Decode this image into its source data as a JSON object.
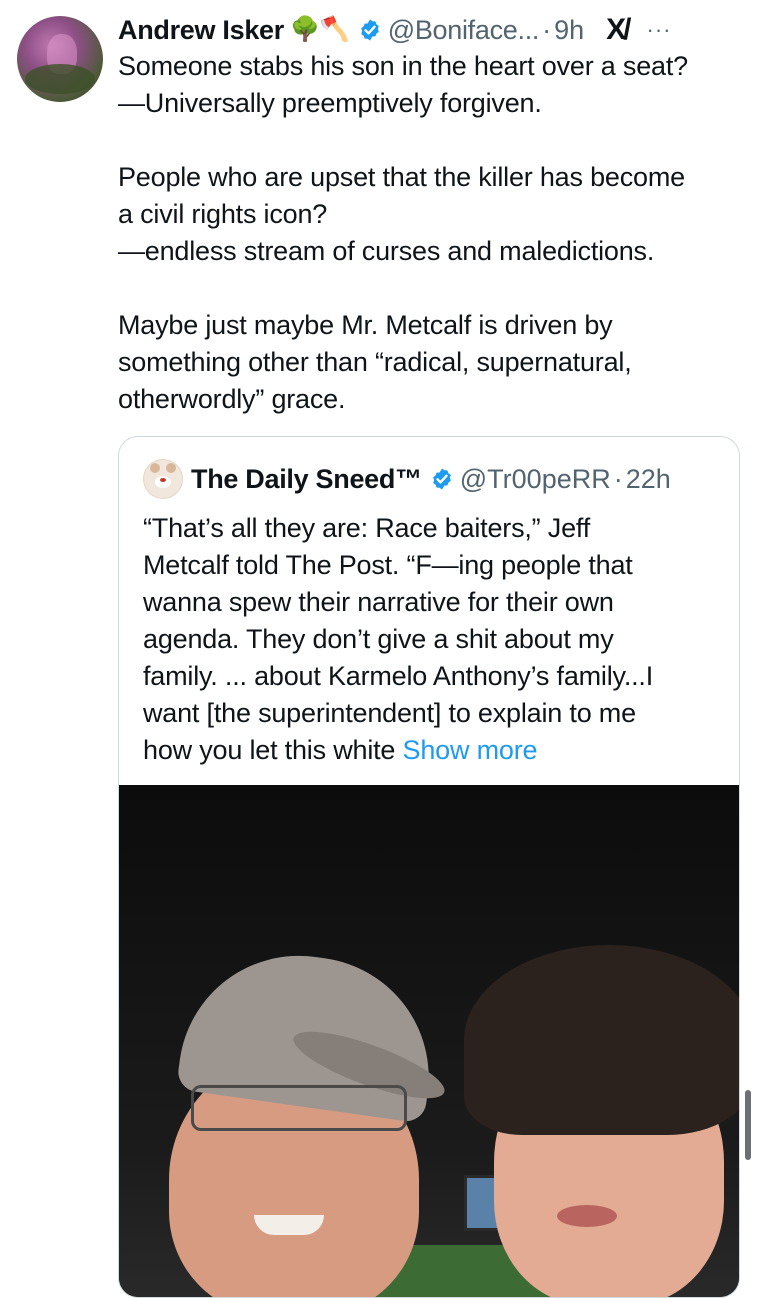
{
  "author": {
    "name": "Andrew Isker",
    "emojis": "🌳🪓",
    "handle": "@Boniface...",
    "time": "9h",
    "verified_color": "#1d9bf0"
  },
  "tweet_lines": [
    "Someone stabs his son in the heart over a seat?",
    "—Universally preemptively forgiven.",
    "",
    "People who are upset that the killer has become",
    "a civil rights icon?",
    "—endless stream of curses and maledictions.",
    "",
    "Maybe just maybe Mr. Metcalf is driven by",
    "something other than “radical, supernatural,",
    "otherwordly” grace."
  ],
  "quoted": {
    "name": "The Daily Sneed™",
    "handle": "@Tr00peRR",
    "time": "22h",
    "text_lines": [
      "“That’s all they are: Race baiters,” Jeff",
      "Metcalf told The Post. “F—ing people that",
      "wanna spew their narrative for their own",
      "agenda. They don’t give a shit about my",
      "family. ... about Karmelo Anthony’s family...I",
      "want [the superintendent] to explain to me",
      "how you let this white"
    ],
    "show_more": "Show more"
  },
  "icons": {
    "verified": "verified-badge-icon",
    "grok": "grok-icon",
    "more": "more-options-icon"
  },
  "dot": "·",
  "more_glyph": "···",
  "grok_glyph": "X/"
}
